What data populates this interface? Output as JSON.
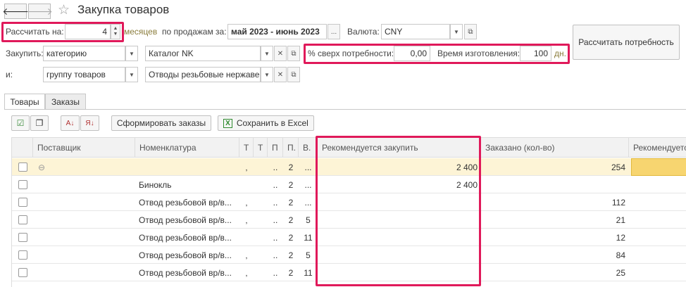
{
  "window": {
    "title": "Закупка товаров"
  },
  "params": {
    "calc_label": "Рассчитать на:",
    "calc_value": "4",
    "months_label": "месяцев",
    "by_sales_label": "по продажам за:",
    "period_value": "май 2023 - июнь 2023",
    "currency_label": "Валюта:",
    "currency_value": "CNY",
    "buy_label": "Закупить:",
    "buy_by_value": "категорию",
    "catalog_value": "Каталог NK",
    "and_label": "и:",
    "and_by_value": "группу товаров",
    "group_value": "Отводы резьбовые нержавею",
    "pct_label": "% сверх потребности:",
    "pct_value": "0,00",
    "mfg_label": "Время изготовления:",
    "mfg_value": "100",
    "mfg_unit": "дн."
  },
  "buttons": {
    "calc_need": "Рассчитать потребность",
    "form_orders": "Сформировать заказы",
    "save_excel": "Сохранить в Excel"
  },
  "tabs": [
    "Товары",
    "Заказы"
  ],
  "table": {
    "headers": [
      "Поставщик",
      "Номенклатура",
      "Т",
      "Т",
      "П",
      "П.",
      "В.",
      "Рекомендуется закупить",
      "Заказано (кол-во)",
      "Рекомендуется"
    ],
    "rows": [
      {
        "supplier": "",
        "name": "",
        "c1": "‚",
        "c2": "",
        "c3": "..",
        "c4": "2",
        "c5": "...",
        "recommend": "2 400",
        "ordered": "254"
      },
      {
        "supplier": "",
        "name": "Бинокль",
        "c1": "",
        "c2": "",
        "c3": "..",
        "c4": "2",
        "c5": "...",
        "recommend": "2 400",
        "ordered": ""
      },
      {
        "supplier": "",
        "name": "Отвод резьбовой вр/в...",
        "c1": "‚",
        "c2": "",
        "c3": "..",
        "c4": "2",
        "c5": "...",
        "recommend": "",
        "ordered": "112"
      },
      {
        "supplier": "",
        "name": "Отвод резьбовой вр/в...",
        "c1": "‚",
        "c2": "",
        "c3": "..",
        "c4": "2",
        "c5": "5",
        "recommend": "",
        "ordered": "21"
      },
      {
        "supplier": "",
        "name": "Отвод резьбовой вр/в...",
        "c1": "",
        "c2": "",
        "c3": "..",
        "c4": "2",
        "c5": "11",
        "recommend": "",
        "ordered": "12"
      },
      {
        "supplier": "",
        "name": "Отвод резьбовой вр/в...",
        "c1": "‚",
        "c2": "",
        "c3": "..",
        "c4": "2",
        "c5": "5",
        "recommend": "",
        "ordered": "84"
      },
      {
        "supplier": "",
        "name": "Отвод резьбовой вр/в...",
        "c1": "‚",
        "c2": "",
        "c3": "..",
        "c4": "2",
        "c5": "11",
        "recommend": "",
        "ordered": "25"
      }
    ]
  },
  "colors": {
    "highlight": "#e0195a",
    "selected_row": "#fdf4d6",
    "selected_cell": "#f7d570",
    "link": "#8b7d3c"
  }
}
